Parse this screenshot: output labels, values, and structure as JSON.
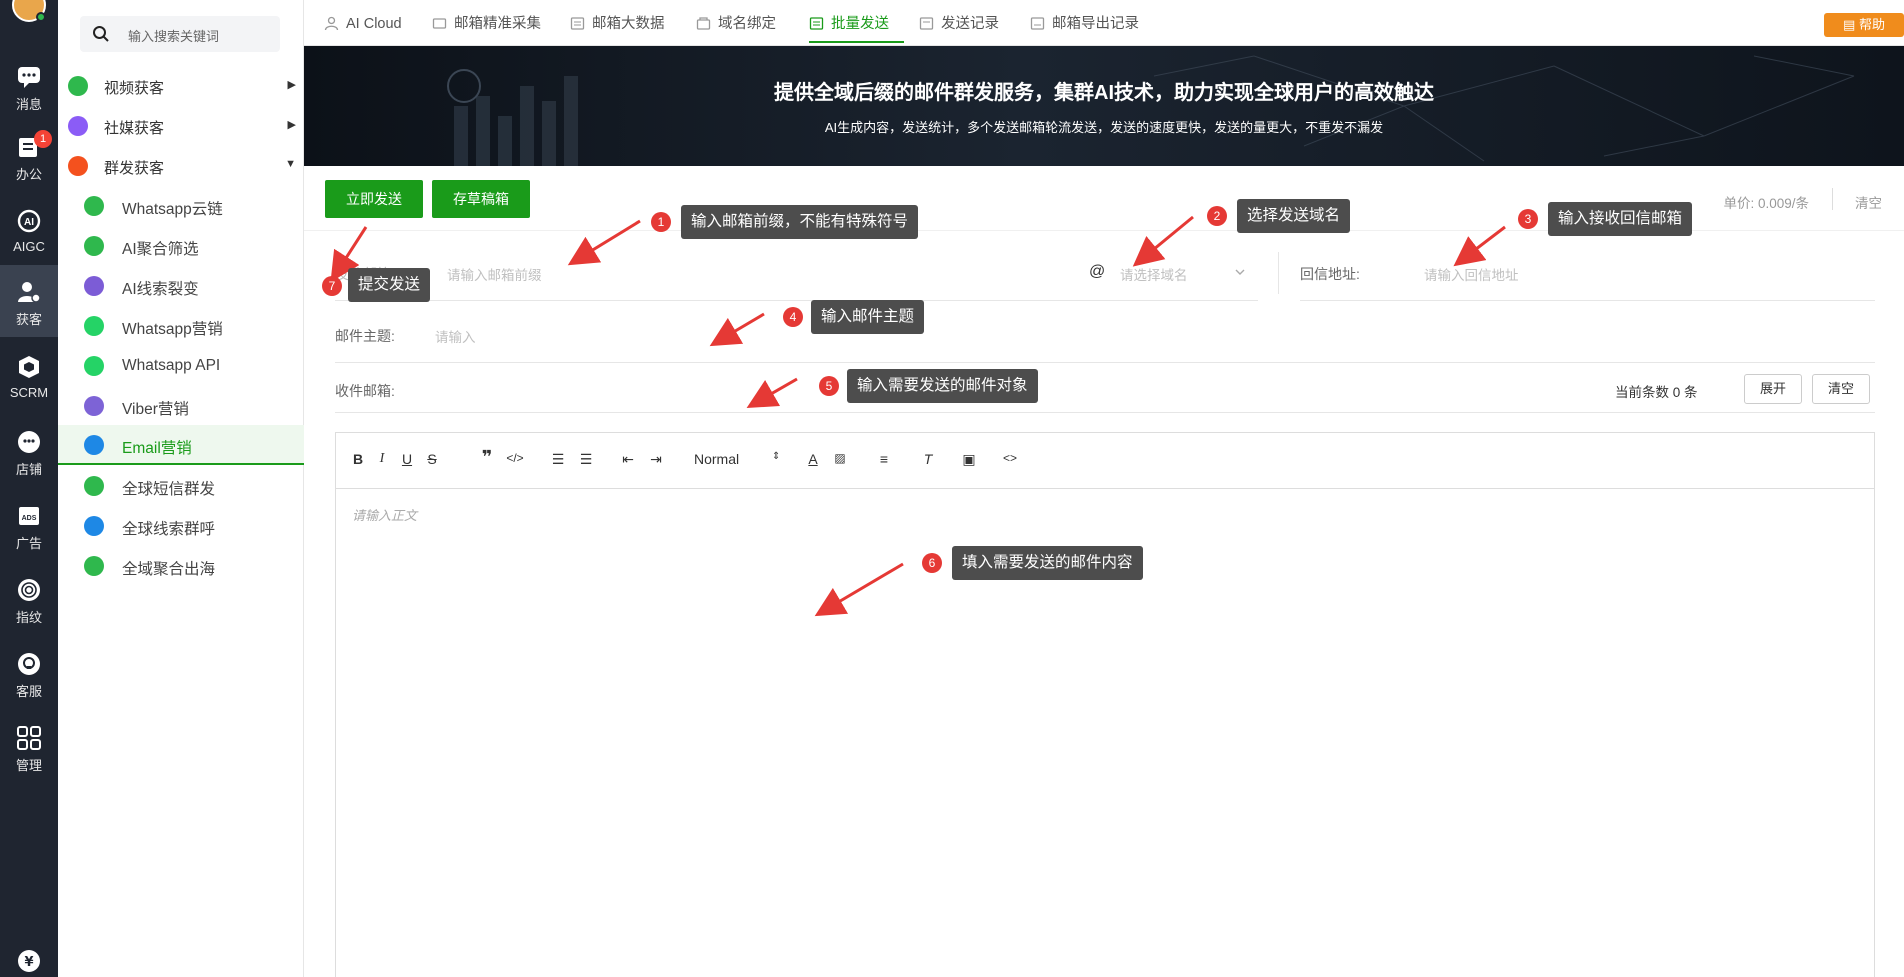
{
  "rail": {
    "items": [
      {
        "label": "消息",
        "icon": "message-icon"
      },
      {
        "label": "办公",
        "icon": "office-icon",
        "badge": "1"
      },
      {
        "label": "AIGC",
        "icon": "ai-icon"
      },
      {
        "label": "获客",
        "icon": "user-add-icon"
      },
      {
        "label": "SCRM",
        "icon": "scrm-icon"
      },
      {
        "label": "店铺",
        "icon": "shop-icon"
      },
      {
        "label": "广告",
        "icon": "ads-icon"
      },
      {
        "label": "指纹",
        "icon": "fingerprint-icon"
      },
      {
        "label": "客服",
        "icon": "customer-service-icon"
      },
      {
        "label": "管理",
        "icon": "grid-icon"
      }
    ]
  },
  "side": {
    "search_placeholder": "输入搜索关键词",
    "groups": [
      {
        "label": "视频获客",
        "color": "#2fb84d"
      },
      {
        "label": "社媒获客",
        "color": "#8b5cf6"
      },
      {
        "label": "群发获客",
        "color": "#f4511e"
      }
    ],
    "items": [
      {
        "label": "Whatsapp云链",
        "color": "#2fb84d"
      },
      {
        "label": "AI聚合筛选",
        "color": "#2fb84d"
      },
      {
        "label": "AI线索裂变",
        "color": "#7c5cd6"
      },
      {
        "label": "Whatsapp营销",
        "color": "#25d366"
      },
      {
        "label": "Whatsapp API",
        "color": "#25d366"
      },
      {
        "label": "Viber营销",
        "color": "#7d63d6"
      },
      {
        "label": "Email营销",
        "color": "#1e88e5"
      },
      {
        "label": "全球短信群发",
        "color": "#2fb84d"
      },
      {
        "label": "全球线索群呼",
        "color": "#1e88e5"
      },
      {
        "label": "全域聚合出海",
        "color": "#2fb84d"
      }
    ]
  },
  "tabs": [
    {
      "label": "AI Cloud"
    },
    {
      "label": "邮箱精准采集"
    },
    {
      "label": "邮箱大数据"
    },
    {
      "label": "域名绑定"
    },
    {
      "label": "批量发送"
    },
    {
      "label": "发送记录"
    },
    {
      "label": "邮箱导出记录"
    }
  ],
  "help_label": "帮助",
  "banner": {
    "title": "提供全域后缀的邮件群发服务，集群AI技术，助力实现全球用户的高效触达",
    "subtitle": "AI生成内容，发送统计，多个发送邮箱轮流发送，发送的速度更快，发送的量更大，不重发不漏发"
  },
  "toolbar": {
    "send_now": "立即发送",
    "save_draft": "存草稿箱",
    "price": "单价: 0.009/条",
    "clear": "清空"
  },
  "form": {
    "sender_label": "发件邮箱:",
    "sender_placeholder": "请输入邮箱前缀",
    "at": "@",
    "domain_placeholder": "请选择域名",
    "reply_label": "回信地址:",
    "reply_placeholder": "请输入回信地址",
    "subject_label": "邮件主题:",
    "subject_placeholder": "请输入",
    "recipients_label": "收件邮箱:",
    "count_text": "当前条数 0 条",
    "expand": "展开",
    "clear": "清空"
  },
  "editor": {
    "format_select": "Normal",
    "body_placeholder": "请输入正文"
  },
  "annotations": [
    {
      "num": "1",
      "text": "输入邮箱前缀，不能有特殊符号"
    },
    {
      "num": "2",
      "text": "选择发送域名"
    },
    {
      "num": "3",
      "text": "输入接收回信邮箱"
    },
    {
      "num": "4",
      "text": "输入邮件主题"
    },
    {
      "num": "5",
      "text": "输入需要发送的邮件对象"
    },
    {
      "num": "6",
      "text": "填入需要发送的邮件内容"
    },
    {
      "num": "7",
      "text": "提交发送"
    }
  ]
}
